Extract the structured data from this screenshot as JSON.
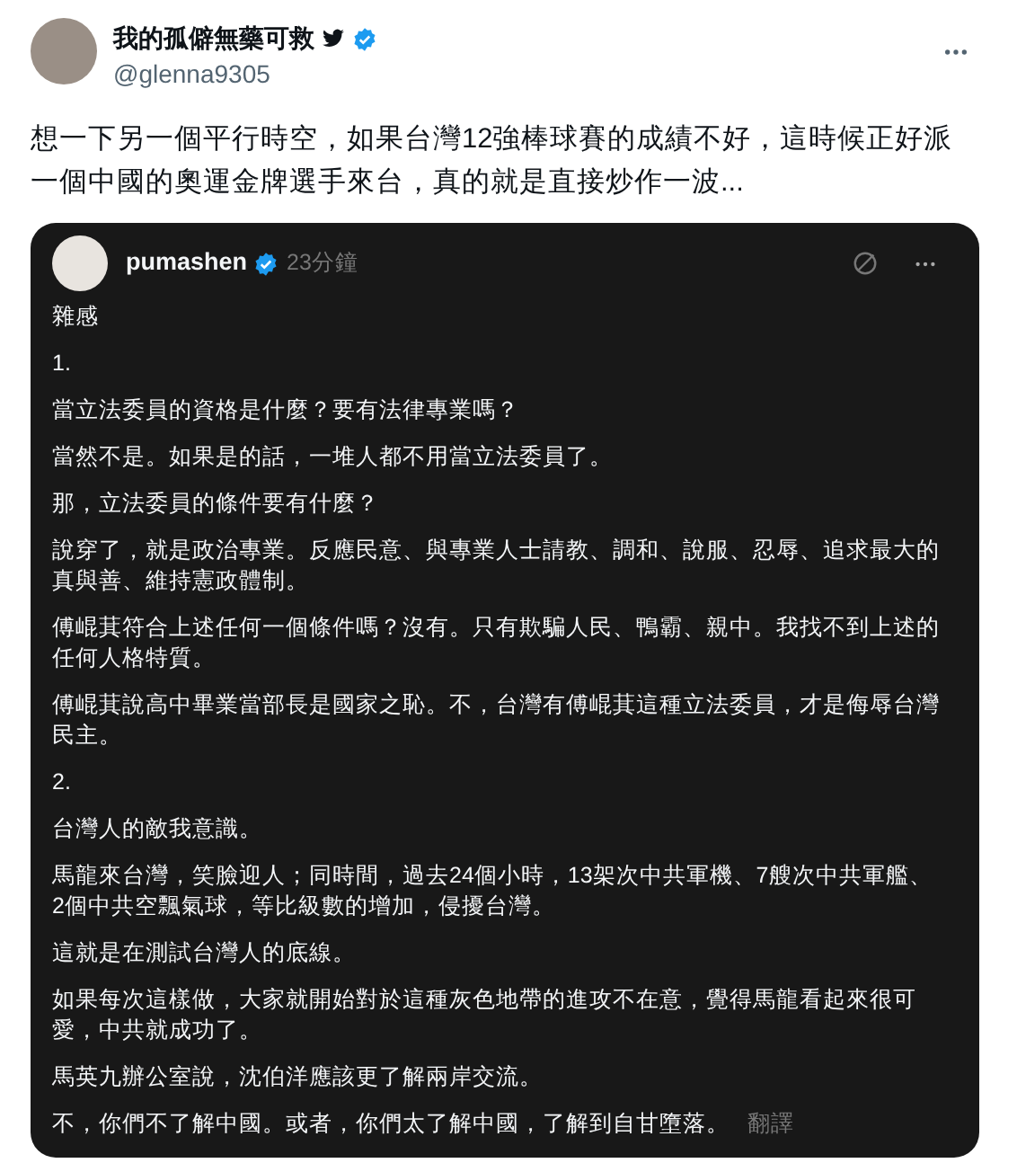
{
  "author": {
    "name": "我的孤僻無藥可救",
    "handle": "@glenna9305"
  },
  "tweet_text": "想一下另一個平行時空，如果台灣12強棒球賽的成績不好，這時候正好派一個中國的奧運金牌選手來台，真的就是直接炒作一波...",
  "embedded_post": {
    "username": "pumashen",
    "time": "23分鐘",
    "paragraphs": [
      "雜感",
      "1.",
      "當立法委員的資格是什麼？要有法律專業嗎？",
      "當然不是。如果是的話，一堆人都不用當立法委員了。",
      "那，立法委員的條件要有什麼？",
      "說穿了，就是政治專業。反應民意、與專業人士請教、調和、說服、忍辱、追求最大的真與善、維持憲政體制。",
      "傅崐萁符合上述任何一個條件嗎？沒有。只有欺騙人民、鴨霸、親中。我找不到上述的任何人格特質。",
      "傅崐萁說高中畢業當部長是國家之恥。不，台灣有傅崐萁這種立法委員，才是侮辱台灣民主。",
      "2.",
      "台灣人的敵我意識。",
      "馬龍來台灣，笑臉迎人；同時間，過去24個小時，13架次中共軍機、7艘次中共軍艦、2個中共空飄氣球，等比級數的增加，侵擾台灣。",
      "這就是在測試台灣人的底線。",
      "如果每次這樣做，大家就開始對於這種灰色地帶的進攻不在意，覺得馬龍看起來很可愛，中共就成功了。",
      "馬英九辦公室說，沈伯洋應該更了解兩岸交流。",
      "不，你們不了解中國。或者，你們太了解中國，了解到自甘墮落。"
    ],
    "translate_label": "翻譯"
  }
}
